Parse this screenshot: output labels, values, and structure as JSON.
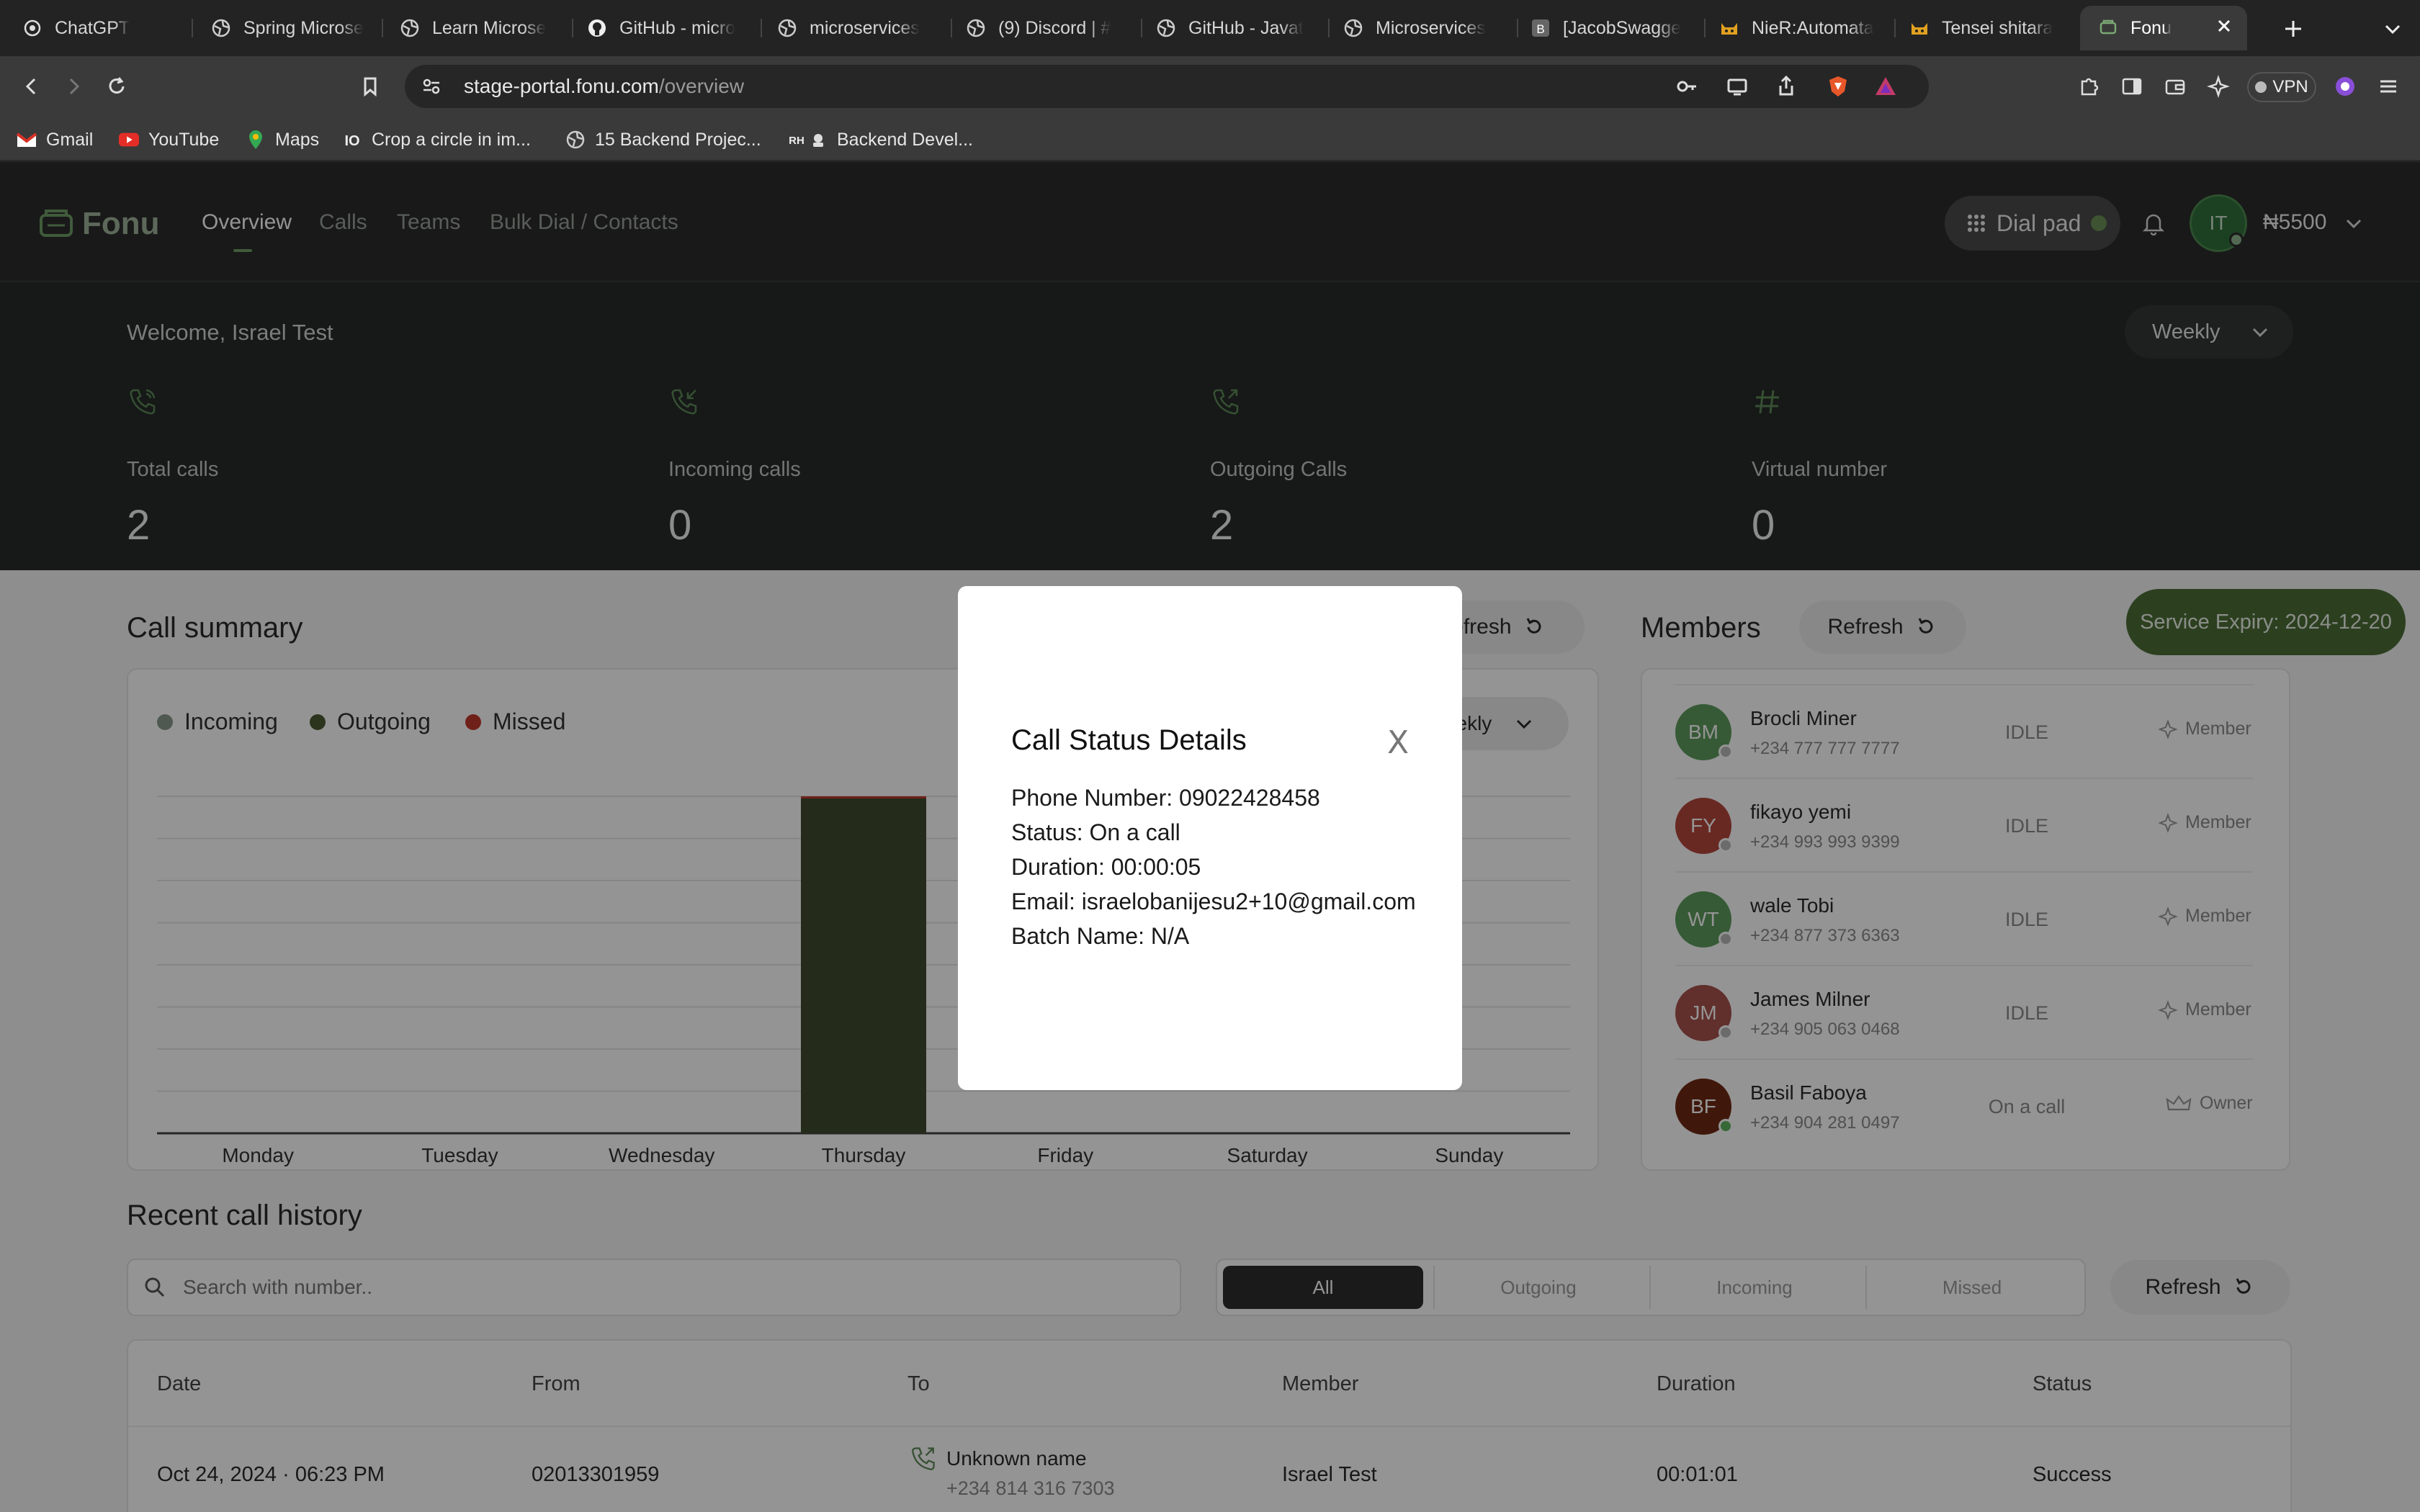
{
  "browser": {
    "tabs": [
      {
        "title": "ChatGPT",
        "icon": "chatgpt-icon"
      },
      {
        "title": "Spring Microse",
        "icon": "globe-icon"
      },
      {
        "title": "Learn Microse",
        "icon": "globe-icon"
      },
      {
        "title": "GitHub - micro",
        "icon": "github-icon"
      },
      {
        "title": "microservices",
        "icon": "globe-icon"
      },
      {
        "title": "(9) Discord | #",
        "icon": "globe-icon"
      },
      {
        "title": "GitHub - Javat",
        "icon": "globe-icon"
      },
      {
        "title": "Microservices",
        "icon": "globe-icon"
      },
      {
        "title": "[JacobSwagge",
        "icon": "b-icon"
      },
      {
        "title": "NieR:Automata",
        "icon": "cat-icon"
      },
      {
        "title": "Tensei shitara",
        "icon": "cat-icon"
      },
      {
        "title": "Fonu",
        "icon": "fonu-icon",
        "active": true
      }
    ],
    "url_host": "stage-portal.fonu.com",
    "url_path": "/overview",
    "vpn_label": "VPN",
    "bookmarks": [
      {
        "label": "Gmail",
        "icon": "gmail-icon"
      },
      {
        "label": "YouTube",
        "icon": "youtube-icon"
      },
      {
        "label": "Maps",
        "icon": "maps-icon"
      },
      {
        "label": "Crop a circle in im...",
        "icon": "io-icon"
      },
      {
        "label": "15 Backend Projec...",
        "icon": "globe-icon"
      },
      {
        "label": "Backend Devel...",
        "icon": "rh-icon"
      }
    ]
  },
  "app": {
    "brand": "Fonu",
    "nav": [
      "Overview",
      "Calls",
      "Teams",
      "Bulk Dial / Contacts"
    ],
    "dial_pad_label": "Dial pad",
    "user_initials": "IT",
    "balance": "₦5500",
    "welcome": "Welcome, Israel Test",
    "period": "Weekly",
    "stats": [
      {
        "label": "Total calls",
        "value": "2",
        "icon": "phone-icon"
      },
      {
        "label": "Incoming calls",
        "value": "0",
        "icon": "phone-incoming-icon"
      },
      {
        "label": "Outgoing Calls",
        "value": "2",
        "icon": "phone-outgoing-icon"
      },
      {
        "label": "Virtual number",
        "value": "0",
        "icon": "hash-icon"
      }
    ],
    "service_expiry": "Service Expiry: 2024-12-20"
  },
  "call_summary": {
    "title": "Call summary",
    "refresh_label": "Refresh",
    "period": "Weekly",
    "legend": [
      {
        "name": "Incoming",
        "color": "#8a9a8c"
      },
      {
        "name": "Outgoing",
        "color": "#4c5a34"
      },
      {
        "name": "Missed",
        "color": "#c0392b"
      }
    ]
  },
  "chart_data": {
    "type": "bar",
    "categories": [
      "Monday",
      "Tuesday",
      "Wednesday",
      "Thursday",
      "Friday",
      "Saturday",
      "Sunday"
    ],
    "series": [
      {
        "name": "Incoming",
        "values": [
          0,
          0,
          0,
          0,
          0,
          0,
          0
        ]
      },
      {
        "name": "Outgoing",
        "values": [
          0,
          0,
          0,
          2,
          0,
          0,
          0
        ]
      },
      {
        "name": "Missed",
        "values": [
          0,
          0,
          0,
          0,
          0,
          0,
          0
        ]
      }
    ],
    "ylim": [
      0,
      2
    ],
    "grid": true,
    "legend": "top-left"
  },
  "members": {
    "title": "Members",
    "refresh_label": "Refresh",
    "list": [
      {
        "initials": "BM",
        "name": "Brocli Miner",
        "phone": "+234 777 777 7777",
        "status": "IDLE",
        "role": "Member",
        "avatar_color": "#5d9c5d",
        "dot_color": "#b9b9b9"
      },
      {
        "initials": "FY",
        "name": "fikayo yemi",
        "phone": "+234 993 993 9399",
        "status": "IDLE",
        "role": "Member",
        "avatar_color": "#b5473d",
        "dot_color": "#b9b9b9"
      },
      {
        "initials": "WT",
        "name": "wale Tobi",
        "phone": "+234 877 373 6363",
        "status": "IDLE",
        "role": "Member",
        "avatar_color": "#5d9c5d",
        "dot_color": "#b9b9b9"
      },
      {
        "initials": "JM",
        "name": "James Milner",
        "phone": "+234 905 063 0468",
        "status": "IDLE",
        "role": "Member",
        "avatar_color": "#a7514d",
        "dot_color": "#b9b9b9"
      },
      {
        "initials": "BF",
        "name": "Basil Faboya",
        "phone": "+234 904 281 0497",
        "status": "On a call",
        "role": "Owner",
        "avatar_color": "#6e2a14",
        "dot_color": "#5fb35f"
      }
    ]
  },
  "history": {
    "title": "Recent call history",
    "search_placeholder": "Search with number..",
    "filters": [
      "All",
      "Outgoing",
      "Incoming",
      "Missed"
    ],
    "refresh_label": "Refresh",
    "columns": [
      "Date",
      "From",
      "To",
      "Member",
      "Duration",
      "Status"
    ],
    "rows": [
      {
        "date": "Oct 24, 2024 · 06:23 PM",
        "from": "02013301959",
        "to_name": "Unknown name",
        "to_number": "+234 814 316 7303",
        "member": "Israel Test",
        "duration": "00:01:01",
        "status": "Success"
      }
    ]
  },
  "modal": {
    "title": "Call Status Details",
    "close_label": "X",
    "lines": [
      "Phone Number: 09022428458",
      "Status: On a call",
      "Duration: 00:00:05",
      "Email: israelobanijesu2+10@gmail.com",
      "Batch Name: N/A"
    ]
  }
}
